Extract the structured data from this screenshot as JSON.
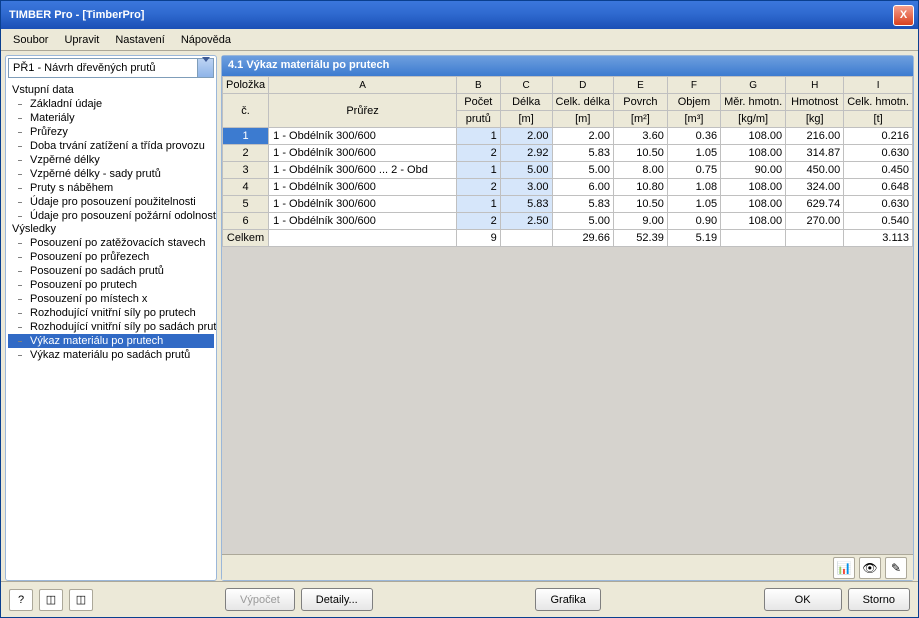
{
  "window": {
    "title": "TIMBER Pro - [TimberPro]",
    "close_x": "X"
  },
  "menu": {
    "items": [
      "Soubor",
      "Upravit",
      "Nastavení",
      "Nápověda"
    ]
  },
  "combo": {
    "label": "PŘ1 - Návrh dřevěných prutů"
  },
  "tree": {
    "group1": {
      "title": "Vstupní data",
      "items": [
        "Základní údaje",
        "Materiály",
        "Průřezy",
        "Doba trvání zatížení a třída provozu",
        "Vzpěrné délky",
        "Vzpěrné délky - sady prutů",
        "Pruty s náběhem",
        "Údaje pro posouzení použitelnosti",
        "Údaje pro posouzení požární odolnosti"
      ]
    },
    "group2": {
      "title": "Výsledky",
      "items": [
        "Posouzení po zatěžovacích stavech",
        "Posouzení po průřezech",
        "Posouzení po sadách prutů",
        "Posouzení po prutech",
        "Posouzení po místech x",
        "Rozhodující vnitřní síly po prutech",
        "Rozhodující vnitřní síly po sadách prutů",
        "Výkaz materiálu po prutech",
        "Výkaz materiálu po sadách prutů"
      ]
    },
    "selected": "Výkaz materiálu po prutech"
  },
  "panel": {
    "title": "4.1 Výkaz materiálu po prutech"
  },
  "grid": {
    "corner1": "Položka",
    "corner2": "č.",
    "letters": [
      "A",
      "B",
      "C",
      "D",
      "E",
      "F",
      "G",
      "H",
      "I"
    ],
    "headers": [
      "Průřez",
      "Počet",
      "Délka",
      "Celk. délka",
      "Povrch",
      "Objem",
      "Měr. hmotn.",
      "Hmotnost",
      "Celk. hmotn."
    ],
    "units": [
      "",
      "prutů",
      "[m]",
      "[m]",
      "[m²]",
      "[m³]",
      "[kg/m]",
      "[kg]",
      "[t]"
    ],
    "rows": [
      {
        "n": "1",
        "a": "1 - Obdélník 300/600",
        "b": "1",
        "c": "2.00",
        "d": "2.00",
        "e": "3.60",
        "f": "0.36",
        "g": "108.00",
        "h": "216.00",
        "i": "0.216"
      },
      {
        "n": "2",
        "a": "1 - Obdélník 300/600",
        "b": "2",
        "c": "2.92",
        "d": "5.83",
        "e": "10.50",
        "f": "1.05",
        "g": "108.00",
        "h": "314.87",
        "i": "0.630"
      },
      {
        "n": "3",
        "a": "1 - Obdélník 300/600 ... 2 - Obd",
        "b": "1",
        "c": "5.00",
        "d": "5.00",
        "e": "8.00",
        "f": "0.75",
        "g": "90.00",
        "h": "450.00",
        "i": "0.450"
      },
      {
        "n": "4",
        "a": "1 - Obdélník 300/600",
        "b": "2",
        "c": "3.00",
        "d": "6.00",
        "e": "10.80",
        "f": "1.08",
        "g": "108.00",
        "h": "324.00",
        "i": "0.648"
      },
      {
        "n": "5",
        "a": "1 - Obdélník 300/600",
        "b": "1",
        "c": "5.83",
        "d": "5.83",
        "e": "10.50",
        "f": "1.05",
        "g": "108.00",
        "h": "629.74",
        "i": "0.630"
      },
      {
        "n": "6",
        "a": "1 - Obdélník 300/600",
        "b": "2",
        "c": "2.50",
        "d": "5.00",
        "e": "9.00",
        "f": "0.90",
        "g": "108.00",
        "h": "270.00",
        "i": "0.540"
      }
    ],
    "total": {
      "label": "Celkem",
      "b": "9",
      "c": "",
      "d": "29.66",
      "e": "52.39",
      "f": "5.19",
      "g": "",
      "h": "",
      "i": "3.113"
    }
  },
  "actions": {
    "vypocet": "Výpočet",
    "detaily": "Detaily...",
    "grafika": "Grafika",
    "ok": "OK",
    "storno": "Storno"
  },
  "icons": {
    "help": "?",
    "q1": "❓",
    "q2": "❓",
    "chart": "📊",
    "eye": "👁",
    "pick": "✎"
  }
}
